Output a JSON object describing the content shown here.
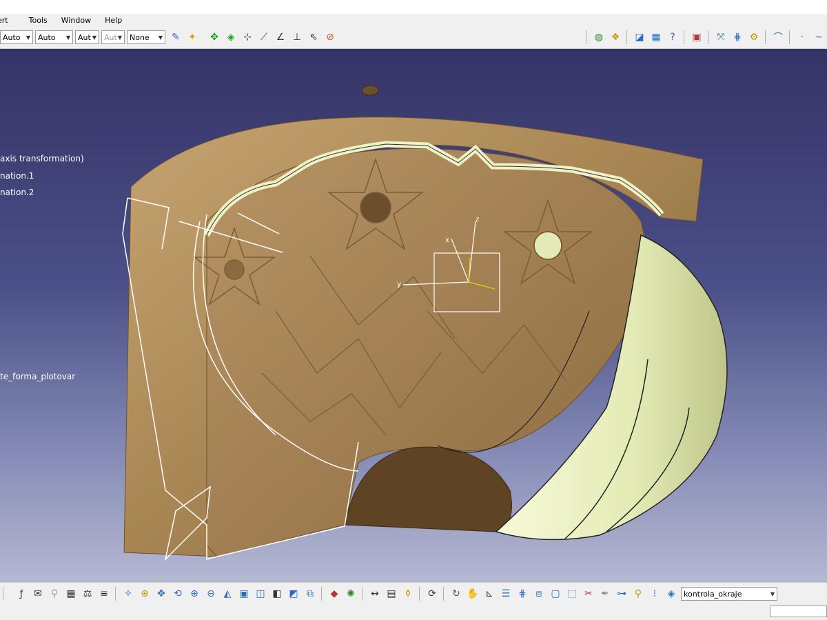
{
  "menu": [
    {
      "label": "ert"
    },
    {
      "label": "Tools"
    },
    {
      "label": "Window"
    },
    {
      "label": "Help"
    }
  ],
  "top_toolbar": {
    "combos": [
      "Auto",
      "Auto",
      "Aut",
      "Aut",
      "None"
    ]
  },
  "spec_tree": {
    "items": [
      {
        "label": "axis transformation)"
      },
      {
        "label": "nation.1"
      },
      {
        "label": "nation.2"
      },
      {
        "label": "te_forma_plotovar"
      }
    ]
  },
  "compass": {
    "axis_x": "x",
    "axis_y": "y",
    "axis_z": "z"
  },
  "bottom_toolbar": {
    "selector_value": "kontrola_okraje"
  },
  "colors": {
    "viewport_top": "#343366",
    "viewport_bottom": "#b6b9d2",
    "part_brown": "#a78553",
    "surface_yellow": "#e9eec0"
  }
}
